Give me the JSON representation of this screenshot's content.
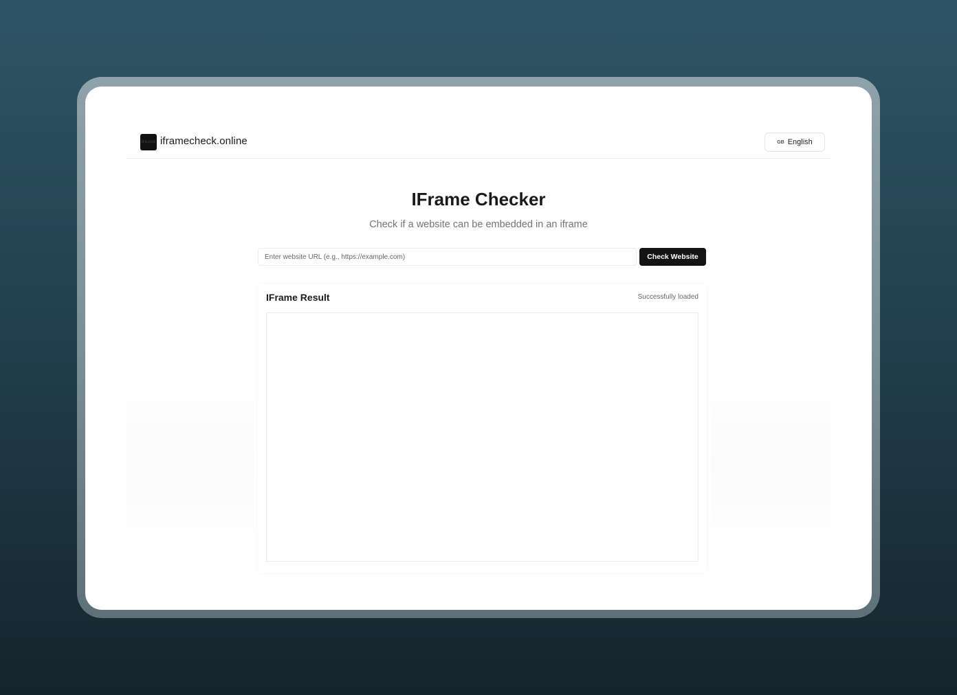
{
  "header": {
    "logo_text": "IFRAME",
    "site_name": "iframecheck.online",
    "language": {
      "flag": "GB",
      "label": "English"
    }
  },
  "hero": {
    "title": "IFrame Checker",
    "subtitle": "Check if a website can be embedded in an iframe"
  },
  "search": {
    "value": "",
    "placeholder": "Enter website URL (e.g., https://example.com)",
    "button_label": "Check Website"
  },
  "result": {
    "title": "IFrame Result",
    "status": "Successfully loaded"
  },
  "colors": {
    "primary_button": "#141414",
    "background_top": "#2e5566",
    "background_bottom": "#15242c"
  }
}
